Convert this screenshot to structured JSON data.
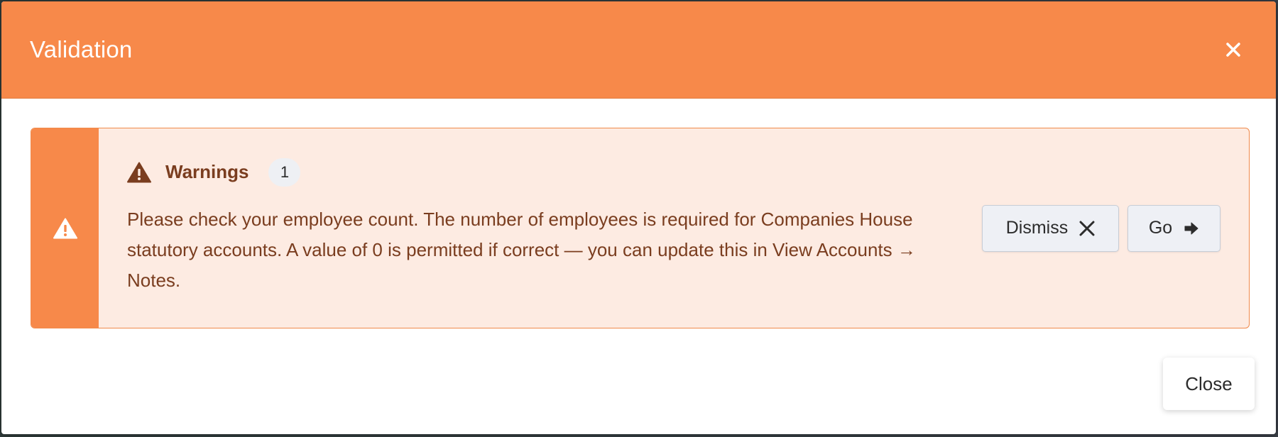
{
  "modal": {
    "title": "Validation",
    "close_icon": "close-icon",
    "header_color": "#f7894a"
  },
  "alert": {
    "side_icon": "warning-icon",
    "heading_icon": "warning-icon",
    "heading": "Warnings",
    "count": "1",
    "message": "Please check your employee count. The number of employees is required for Companies House statutory accounts. A value of 0 is permitted if correct — you can update this in View Accounts → Notes.",
    "text_color": "#7a3d1f",
    "background_color": "#fdebe2",
    "actions": {
      "dismiss_label": "Dismiss",
      "dismiss_icon": "close-icon",
      "go_label": "Go",
      "go_icon": "arrow-right-icon"
    }
  },
  "footer": {
    "close_label": "Close"
  }
}
